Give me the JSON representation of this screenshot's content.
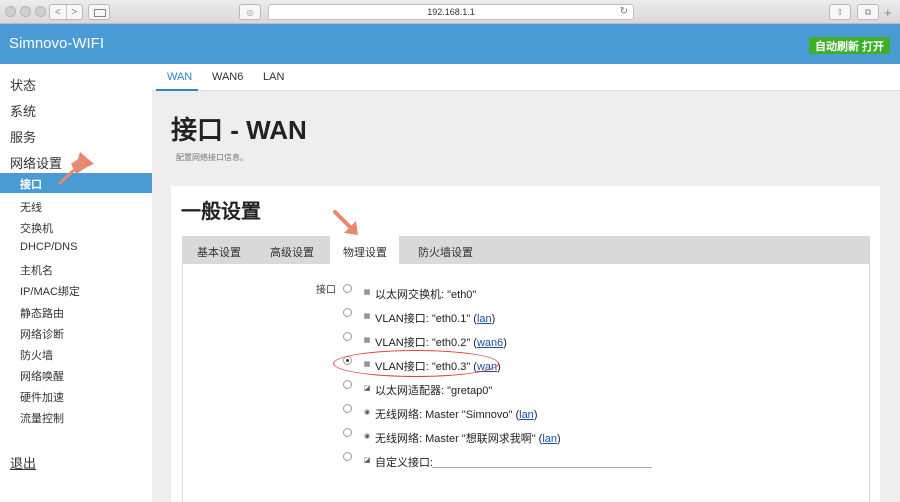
{
  "browser": {
    "url": "192.168.1.1",
    "back_glyph": "<",
    "forward_glyph": ">",
    "share_glyph": "⇧",
    "tabs_glyph": "⧉",
    "newtab_glyph": "+",
    "reload_glyph": "↻",
    "ext_glyph": "◎"
  },
  "header": {
    "brand": "Simnovo-WIFI",
    "auto_refresh": "自动刷新 打开",
    "accent_color": "#4a9ad4",
    "refresh_color": "#3fae2a"
  },
  "sidebar": {
    "top_items": [
      "状态",
      "系统",
      "服务",
      "网络设置"
    ],
    "active_sub": "接口",
    "sub_items": [
      "无线",
      "交换机",
      "DHCP/DNS",
      "主机名",
      "IP/MAC绑定",
      "静态路由",
      "网络诊断",
      "防火墙",
      "网络唤醒",
      "硬件加速",
      "流量控制"
    ],
    "logout": "退出"
  },
  "topnav": {
    "tabs": [
      "WAN",
      "WAN6",
      "LAN"
    ],
    "active": "WAN"
  },
  "page": {
    "title": "接口 - WAN",
    "description": "配置网络接口信息。"
  },
  "section": {
    "title": "一般设置",
    "tabs": [
      "基本设置",
      "高级设置",
      "物理设置",
      "防火墙设置"
    ],
    "active_tab": "物理设置"
  },
  "interface_field": {
    "label": "接口",
    "options": [
      {
        "text": "以太网交换机: \"eth0\"",
        "zone": "",
        "selected": false
      },
      {
        "text": "VLAN接口: \"eth0.1\" (",
        "zone": "lan",
        "suffix": ")",
        "selected": false
      },
      {
        "text": "VLAN接口: \"eth0.2\" (",
        "zone": "wan6",
        "suffix": ")",
        "selected": false
      },
      {
        "text": "VLAN接口: \"eth0.3\" (",
        "zone": "wan",
        "suffix": ")",
        "selected": true
      },
      {
        "text": "以太网适配器: \"gretap0\"",
        "zone": "",
        "selected": false
      },
      {
        "text": "无线网络: Master \"Simnovo\" (",
        "zone": "lan",
        "suffix": ")",
        "selected": false
      },
      {
        "text": "无线网络: Master \"想联网求我啊\" (",
        "zone": "lan",
        "suffix": ")",
        "selected": false
      },
      {
        "text": "自定义接口:",
        "zone": "",
        "selected": false
      }
    ],
    "custom_value": ""
  }
}
